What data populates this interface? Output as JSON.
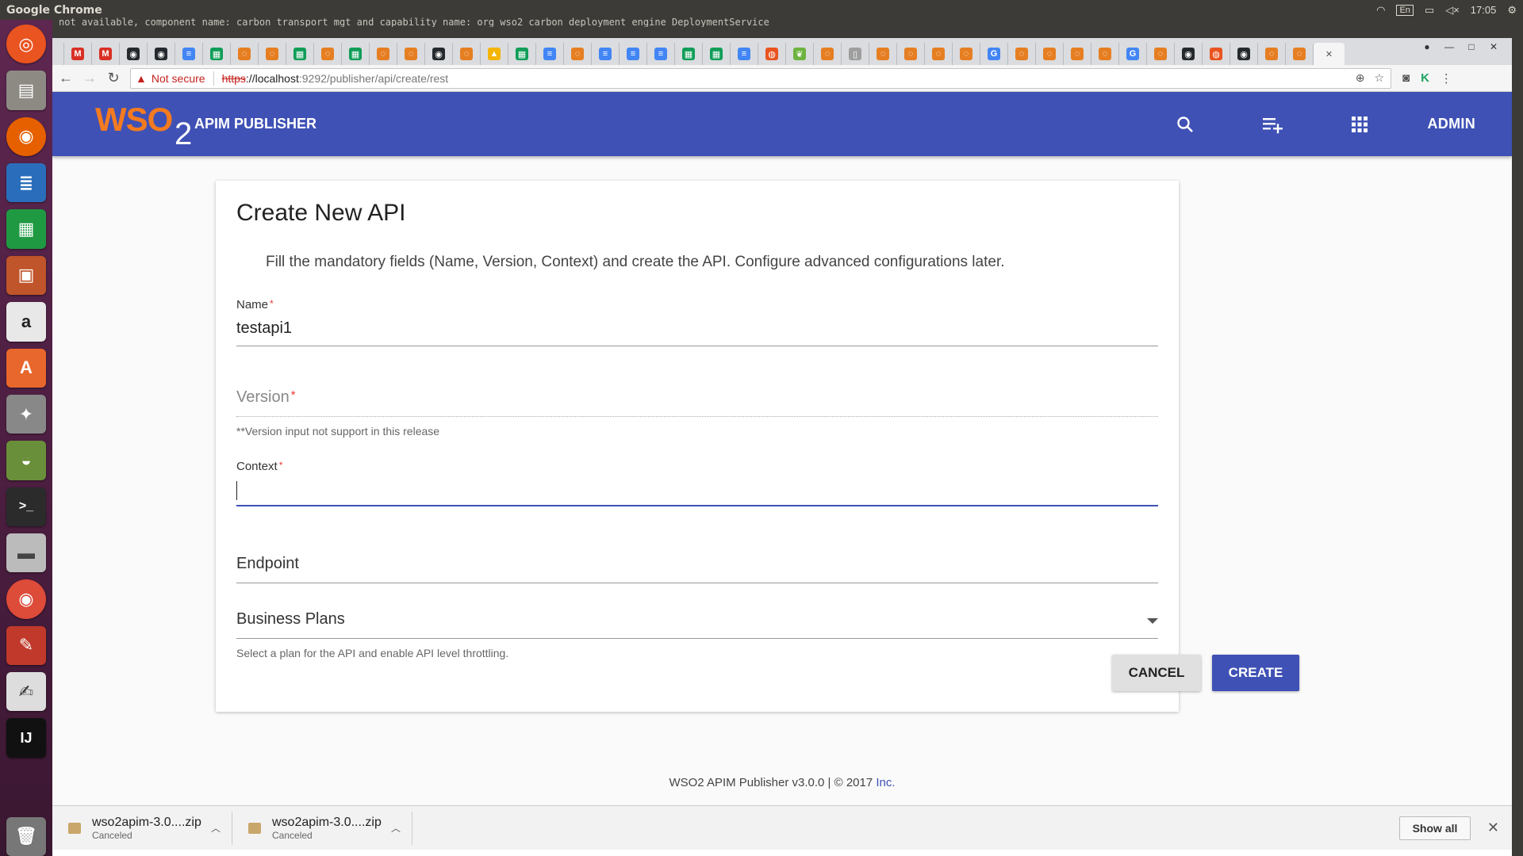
{
  "os": {
    "window_title": "Google Chrome",
    "time": "17:05",
    "keyboard": "En",
    "background_text": "not available, component name: carbon transport mgt and capability name: org wso2 carbon deployment engine DeploymentService"
  },
  "browser": {
    "security_label": "Not secure",
    "url_scheme": "https",
    "url_host": "://localhost",
    "url_path": ":9292/publisher/api/create/rest",
    "tabs": [
      {
        "icon": "gmail-icon",
        "color": "#d93025",
        "glyph": "M"
      },
      {
        "icon": "gmail-icon",
        "color": "#d93025",
        "glyph": "M"
      },
      {
        "icon": "github-icon",
        "color": "#24292e",
        "glyph": "◉"
      },
      {
        "icon": "github-icon",
        "color": "#24292e",
        "glyph": "◉"
      },
      {
        "icon": "docs-icon",
        "color": "#4285f4",
        "glyph": "≡"
      },
      {
        "icon": "sheets-icon",
        "color": "#0f9d58",
        "glyph": "▦"
      },
      {
        "icon": "jira-icon",
        "color": "#e67e22",
        "glyph": "◌"
      },
      {
        "icon": "jira-icon",
        "color": "#e67e22",
        "glyph": "◌"
      },
      {
        "icon": "sheets-icon",
        "color": "#0f9d58",
        "glyph": "▦"
      },
      {
        "icon": "jira-icon",
        "color": "#e67e22",
        "glyph": "◌"
      },
      {
        "icon": "sheets-icon",
        "color": "#0f9d58",
        "glyph": "▦"
      },
      {
        "icon": "jira-icon",
        "color": "#e67e22",
        "glyph": "◌"
      },
      {
        "icon": "jira-icon",
        "color": "#e67e22",
        "glyph": "◌"
      },
      {
        "icon": "github-icon",
        "color": "#24292e",
        "glyph": "◉"
      },
      {
        "icon": "jira-icon",
        "color": "#e67e22",
        "glyph": "◌"
      },
      {
        "icon": "drive-icon",
        "color": "#f4b400",
        "glyph": "▲"
      },
      {
        "icon": "sheets-icon",
        "color": "#0f9d58",
        "glyph": "▦"
      },
      {
        "icon": "docs-icon",
        "color": "#4285f4",
        "glyph": "≡"
      },
      {
        "icon": "jira-icon",
        "color": "#e67e22",
        "glyph": "◌"
      },
      {
        "icon": "docs-icon",
        "color": "#4285f4",
        "glyph": "≡"
      },
      {
        "icon": "docs-icon",
        "color": "#4285f4",
        "glyph": "≡"
      },
      {
        "icon": "docs-icon",
        "color": "#4285f4",
        "glyph": "≡"
      },
      {
        "icon": "sheets-icon",
        "color": "#0f9d58",
        "glyph": "▦"
      },
      {
        "icon": "sheets-icon",
        "color": "#0f9d58",
        "glyph": "▦"
      },
      {
        "icon": "docs-icon",
        "color": "#4285f4",
        "glyph": "≡"
      },
      {
        "icon": "ubuntu-icon",
        "color": "#e95420",
        "glyph": "◍"
      },
      {
        "icon": "leaf-icon",
        "color": "#6db33f",
        "glyph": "❦"
      },
      {
        "icon": "jira-icon",
        "color": "#e67e22",
        "glyph": "◌"
      },
      {
        "icon": "file-icon",
        "color": "#9e9e9e",
        "glyph": "▯"
      },
      {
        "icon": "jira-icon",
        "color": "#e67e22",
        "glyph": "◌"
      },
      {
        "icon": "jira-icon",
        "color": "#e67e22",
        "glyph": "◌"
      },
      {
        "icon": "jira-icon",
        "color": "#e67e22",
        "glyph": "◌"
      },
      {
        "icon": "jira-icon",
        "color": "#e67e22",
        "glyph": "◌"
      },
      {
        "icon": "google-icon",
        "color": "#4285f4",
        "glyph": "G"
      },
      {
        "icon": "jira-icon",
        "color": "#e67e22",
        "glyph": "◌"
      },
      {
        "icon": "jira-icon",
        "color": "#e67e22",
        "glyph": "◌"
      },
      {
        "icon": "jira-icon",
        "color": "#e67e22",
        "glyph": "◌"
      },
      {
        "icon": "jira-icon",
        "color": "#e67e22",
        "glyph": "◌"
      },
      {
        "icon": "google-icon",
        "color": "#4285f4",
        "glyph": "G"
      },
      {
        "icon": "jira-icon",
        "color": "#e67e22",
        "glyph": "◌"
      },
      {
        "icon": "github-icon",
        "color": "#24292e",
        "glyph": "◉"
      },
      {
        "icon": "ubuntu-icon",
        "color": "#e95420",
        "glyph": "◍"
      },
      {
        "icon": "github-icon",
        "color": "#24292e",
        "glyph": "◉"
      },
      {
        "icon": "jira-icon",
        "color": "#e67e22",
        "glyph": "◌"
      },
      {
        "icon": "jira-icon",
        "color": "#e67e22",
        "glyph": "◌"
      }
    ]
  },
  "app": {
    "logo_text": "WSO",
    "logo_sub": "2",
    "title": "APIM PUBLISHER",
    "user": "ADMIN",
    "brand_color": "#3f51b5"
  },
  "form": {
    "heading": "Create New API",
    "description": "Fill the mandatory fields (Name, Version, Context) and create the API. Configure advanced configurations later.",
    "required_mark": "*",
    "name": {
      "label": "Name",
      "value": "testapi1"
    },
    "version": {
      "label": "Version",
      "helper": "**Version input not support in this release"
    },
    "context": {
      "label": "Context",
      "value": ""
    },
    "endpoint": {
      "label": "Endpoint"
    },
    "business_plans": {
      "label": "Business Plans",
      "helper": "Select a plan for the API and enable API level throttling."
    },
    "cancel_label": "CANCEL",
    "create_label": "CREATE"
  },
  "footer": {
    "text": "WSO2 APIM Publisher v3.0.0 | © 2017 ",
    "link": "Inc."
  },
  "downloads": {
    "items": [
      {
        "name": "wso2apim-3.0....zip",
        "status": "Canceled"
      },
      {
        "name": "wso2apim-3.0....zip",
        "status": "Canceled"
      }
    ],
    "show_all": "Show all"
  }
}
